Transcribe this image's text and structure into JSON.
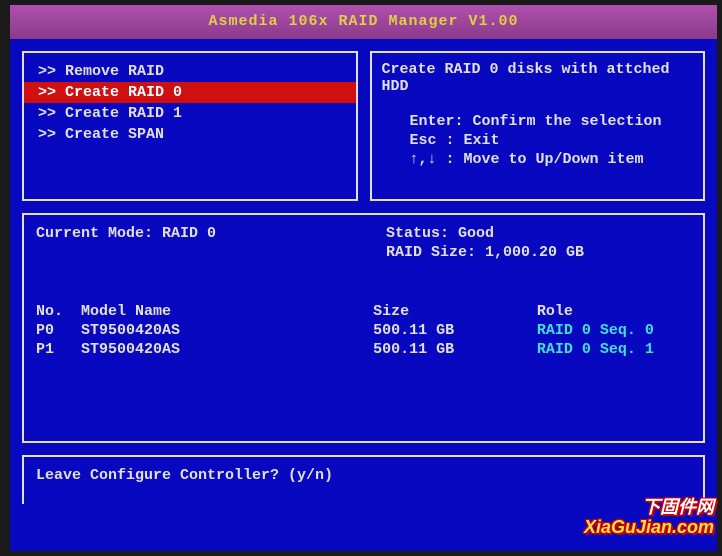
{
  "title": "Asmedia 106x RAID Manager V1.00",
  "menu": {
    "items": [
      {
        "label": ">> Remove RAID",
        "selected": false
      },
      {
        "label": ">> Create RAID 0",
        "selected": true
      },
      {
        "label": ">> Create RAID 1",
        "selected": false
      },
      {
        "label": ">> Create SPAN",
        "selected": false
      }
    ]
  },
  "info": {
    "title": "Create RAID 0 disks with attched HDD",
    "lines": [
      "Enter: Confirm the selection",
      "Esc  : Exit",
      "↑,↓  : Move to Up/Down item"
    ]
  },
  "detail": {
    "current_mode_label": "Current Mode:",
    "current_mode_value": "RAID 0",
    "status_label": "Status:",
    "status_value": "Good",
    "raid_size_label": "RAID Size:",
    "raid_size_value": "1,000.20 GB",
    "headers": {
      "no": "No.",
      "model": "Model Name",
      "size": "Size",
      "role": "Role"
    },
    "disks": [
      {
        "no": "P0",
        "model": "ST9500420AS",
        "size": "500.11 GB",
        "role": "RAID 0 Seq. 0"
      },
      {
        "no": "P1",
        "model": "ST9500420AS",
        "size": "500.11 GB",
        "role": "RAID 0 Seq. 1"
      }
    ]
  },
  "prompt": "Leave Configure Controller? (y/n)",
  "watermark": {
    "line1": "下固件网",
    "line2": "XiaGuJian.com"
  }
}
